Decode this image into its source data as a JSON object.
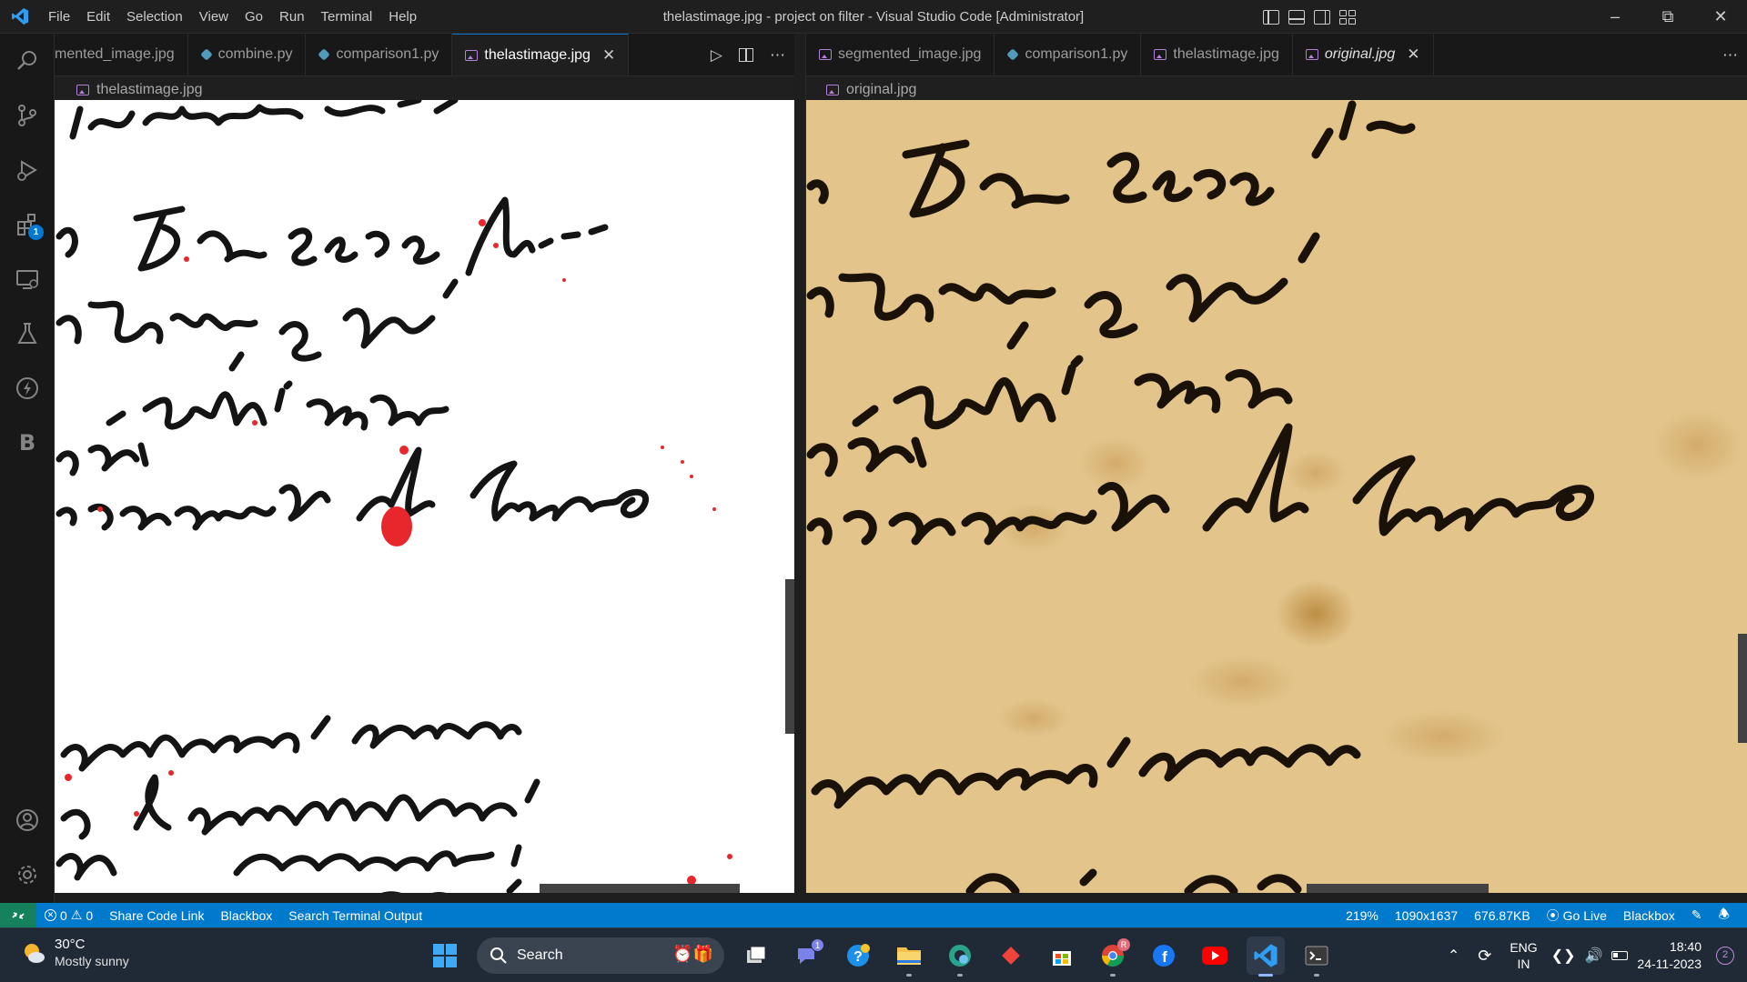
{
  "window": {
    "title": "thelastimage.jpg - project on filter - Visual Studio Code [Administrator]",
    "menu": [
      "File",
      "Edit",
      "Selection",
      "View",
      "Go",
      "Run",
      "Terminal",
      "Help"
    ]
  },
  "activity_bar": {
    "items": [
      "explorer-icon",
      "source-control-icon",
      "run-debug-icon",
      "extensions-icon",
      "remote-explorer-icon",
      "testing-icon",
      "thunder-client-icon",
      "blackbox-icon"
    ],
    "extensions_badge": "1",
    "blackbox_letter": "B"
  },
  "left_group": {
    "tabs": [
      {
        "label": "mented_image.jpg",
        "kind": "image"
      },
      {
        "label": "combine.py",
        "kind": "python"
      },
      {
        "label": "comparison1.py",
        "kind": "python"
      },
      {
        "label": "thelastimage.jpg",
        "kind": "image",
        "active": true
      }
    ],
    "breadcrumb": "thelastimage.jpg"
  },
  "right_group": {
    "tabs": [
      {
        "label": "segmented_image.jpg",
        "kind": "image"
      },
      {
        "label": "comparison1.py",
        "kind": "python"
      },
      {
        "label": "thelastimage.jpg",
        "kind": "image"
      },
      {
        "label": "original.jpg",
        "kind": "image",
        "active": true
      }
    ],
    "breadcrumb": "original.jpg"
  },
  "statusbar": {
    "problems_errors": "0",
    "problems_warnings": "0",
    "left_items": [
      "Share Code Link",
      "Blackbox",
      "Search Terminal Output"
    ],
    "zoom": "219%",
    "dimensions": "1090x1637",
    "filesize": "676.87KB",
    "go_live": "Go Live",
    "blackbox": "Blackbox"
  },
  "taskbar": {
    "temperature": "30°C",
    "weather": "Mostly sunny",
    "search_label": "Search",
    "language": "ENG",
    "region": "IN",
    "time": "18:40",
    "date": "24-11-2023",
    "notifications": "2",
    "teams_badge": "1",
    "chrome_badge": "R"
  },
  "colors": {
    "accent": "#0078d4",
    "statusbar": "#007acc",
    "parchment": "#e3c58c",
    "ink": "#1a1208",
    "mask_red": "#e8272d"
  }
}
